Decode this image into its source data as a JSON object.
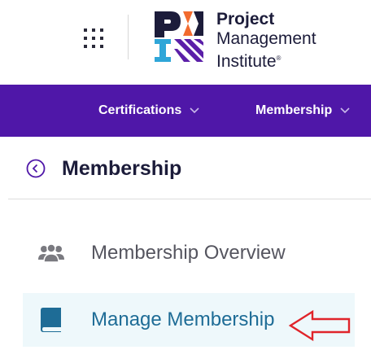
{
  "header": {
    "logo_line1": "Project",
    "logo_line2": "Management",
    "logo_line3": "Institute",
    "logo_mark": "®"
  },
  "nav": {
    "items": [
      {
        "label": "Certifications"
      },
      {
        "label": "Membership"
      }
    ]
  },
  "section": {
    "title": "Membership"
  },
  "menu": {
    "items": [
      {
        "label": "Membership Overview",
        "icon": "people-group-icon"
      },
      {
        "label": "Manage Membership",
        "icon": "book-icon",
        "active": true
      }
    ]
  },
  "colors": {
    "nav_bg": "#4f17a8",
    "active_bg": "#eef8fb",
    "active_text": "#1e6c96",
    "annotation": "#e0242a"
  }
}
